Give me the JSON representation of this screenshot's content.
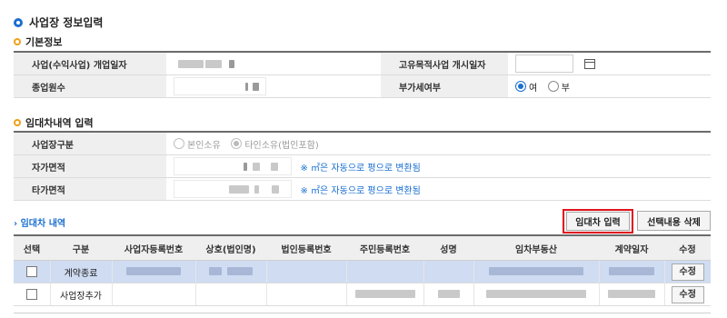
{
  "page_title": "사업장 정보입력",
  "basic": {
    "section_title": "기본정보",
    "open_date_label": "사업(수익사업) 개업일자",
    "unique_start_label": "고유목적사업 개시일자",
    "employees_label": "종업원수",
    "vat_label": "부가세여부",
    "vat_options": [
      "여",
      "부"
    ],
    "vat_selected": "여"
  },
  "lease": {
    "section_title": "임대차내역 입력",
    "type_label": "사업장구분",
    "type_options": [
      "본인소유",
      "타인소유(법인포함)"
    ],
    "type_selected": "타인소유(법인포함)",
    "own_area_label": "자가면적",
    "other_area_label": "타가면적",
    "conversion_hint": "※ ㎡은 자동으로 평으로 변환됨"
  },
  "lease_list": {
    "title": "임대차 내역",
    "input_button": "임대차 입력",
    "delete_button": "선택내용 삭제",
    "columns": [
      "선택",
      "구분",
      "사업자등록번호",
      "상호(법인명)",
      "법인등록번호",
      "주민등록번호",
      "성명",
      "임차부동산",
      "계약일자",
      "수정"
    ],
    "rows": [
      {
        "type": "계약종료",
        "edit": "수정"
      },
      {
        "type": "사업장추가",
        "edit": "수정"
      }
    ]
  },
  "colors": {
    "accent_blue": "#1a6fd0",
    "highlight_red": "#e0141e",
    "selected_row": "#cfdcf2"
  }
}
